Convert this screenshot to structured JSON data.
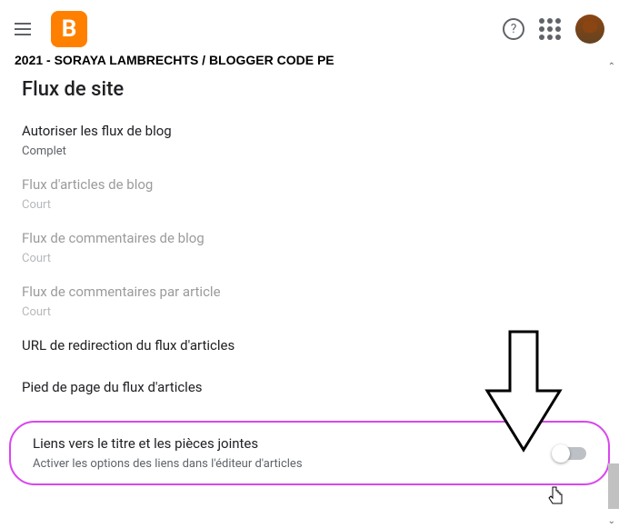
{
  "header": {
    "logo_letter": "B"
  },
  "watermark": "2021 - SORAYA LAMBRECHTS / BLOGGER CODE PE",
  "section_title": "Flux de site",
  "settings": {
    "allow_blog_feed": {
      "label": "Autoriser les flux de blog",
      "value": "Complet"
    },
    "article_feed": {
      "label": "Flux d'articles de blog",
      "value": "Court"
    },
    "comment_feed": {
      "label": "Flux de commentaires de blog",
      "value": "Court"
    },
    "comment_per_article": {
      "label": "Flux de commentaires par article",
      "value": "Court"
    },
    "redirect_url": "URL de redirection du flux d'articles",
    "footer": "Pied de page du flux d'articles",
    "title_links": {
      "label": "Liens vers le titre et les pièces jointes",
      "desc": "Activer les options des liens dans l'éditeur d'articles"
    }
  }
}
